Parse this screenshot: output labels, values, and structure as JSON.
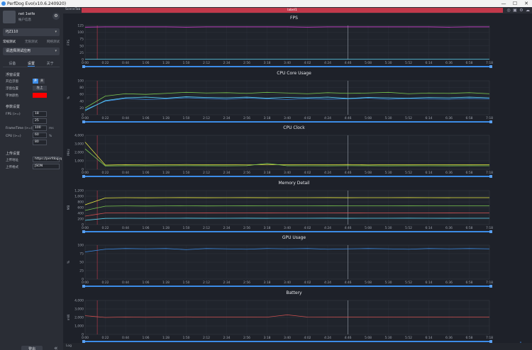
{
  "window": {
    "title": "PerfDog Evo(v10.6.240920)",
    "minimize": "—",
    "maximize": "☐",
    "close": "✕"
  },
  "user": {
    "name": "net 1wife",
    "status": "帐户信息",
    "bell": "⚙"
  },
  "device": {
    "label": "PJZ110",
    "dropdown": "▾"
  },
  "modes": [
    "常规测试",
    "无限测试",
    "网络测试"
  ],
  "app_select": {
    "label": "请选择测试应用",
    "dropdown": "▾"
  },
  "tabs": [
    "设备",
    "设置",
    "关于"
  ],
  "settings": {
    "section_float": "浮窗设置",
    "show_float": "开启浮窗",
    "show_float_on": "开",
    "show_float_off": "关",
    "float_position": "浮窗位置",
    "float_position_value": "左上",
    "font_color": "字体颜色",
    "font_color_hex": "#ff0000",
    "section_params": "参数设置",
    "fps_label": "FPS (>=)",
    "fps_v1": "18",
    "fps_v2": "25",
    "frametime_label": "FrameTime (>=)",
    "frametime_value": "100",
    "frametime_unit": "ms",
    "cpu_label": "CPU (>=)",
    "cpu_v1": "60",
    "cpu_v2": "80",
    "cpu_unit": "%",
    "section_upload": "上传设置",
    "upload_addr_label": "上传地址",
    "upload_addr_value": "https://perfdog.q",
    "upload_fmt_label": "上传格式",
    "upload_fmt_value": "JSON"
  },
  "footer": {
    "login": "登出",
    "collapse": "«",
    "log": "Log"
  },
  "topstrip": {
    "scene": "SceneTab",
    "label": "label1"
  },
  "colors": {
    "accent": "#3c8ce7",
    "label_bar": "#c2394b",
    "grid": "#2e323c"
  },
  "time_ticks": [
    "0:00",
    "0:22",
    "0:44",
    "1:06",
    "1:28",
    "1:50",
    "2:12",
    "2:34",
    "2:56",
    "3:18",
    "3:40",
    "4:02",
    "4:24",
    "4:46",
    "5:08",
    "5:30",
    "5:52",
    "6:14",
    "6:36",
    "6:58",
    "7:18"
  ],
  "chart_data": [
    {
      "type": "line",
      "title": "FPS",
      "ylabel": "FPS",
      "y_ticks": [
        "0",
        "25",
        "50",
        "75",
        "100",
        "125"
      ],
      "ylim": [
        0,
        125
      ],
      "series": [
        {
          "color": "#d040d0",
          "values": [
            119,
            120,
            120,
            120,
            120,
            119,
            120,
            120,
            120,
            120,
            120,
            119,
            120,
            120,
            120,
            120,
            120,
            120,
            119,
            120,
            120
          ]
        },
        {
          "color": "#5ad0f0",
          "values": [
            1,
            1,
            1,
            1,
            1,
            1,
            1,
            1,
            1,
            1,
            1,
            1,
            1,
            1,
            1,
            1,
            1,
            1,
            1,
            1,
            1
          ]
        }
      ]
    },
    {
      "type": "line",
      "title": "CPU Core Usage",
      "ylabel": "%",
      "y_ticks": [
        "0",
        "20",
        "40",
        "60",
        "80",
        "100"
      ],
      "ylim": [
        0,
        100
      ],
      "series": [
        {
          "color": "#7ac74f",
          "values": [
            20,
            55,
            62,
            60,
            63,
            66,
            64,
            65,
            63,
            66,
            64,
            62,
            65,
            63,
            64,
            66,
            62,
            64,
            63,
            65,
            62
          ]
        },
        {
          "color": "#3c8ce7",
          "values": [
            15,
            40,
            48,
            45,
            47,
            50,
            48,
            46,
            49,
            47,
            45,
            48,
            46,
            47,
            49,
            46,
            48,
            47,
            46,
            48,
            47
          ]
        },
        {
          "color": "#5ad0f0",
          "values": [
            12,
            42,
            50,
            52,
            49,
            53,
            51,
            50,
            52,
            49,
            51,
            50,
            52,
            48,
            51,
            50,
            49,
            51,
            50,
            52,
            50
          ]
        }
      ]
    },
    {
      "type": "line",
      "title": "CPU Clock",
      "ylabel": "MHz",
      "y_ticks": [
        "0",
        "1,000",
        "2,000",
        "3,000",
        "4,000"
      ],
      "ylim": [
        0,
        4000
      ],
      "series": [
        {
          "color": "#e8e840",
          "values": [
            3200,
            500,
            550,
            520,
            540,
            560,
            530,
            540,
            520,
            560,
            540,
            530,
            540,
            560,
            520,
            540,
            530,
            550,
            540,
            530,
            540
          ]
        },
        {
          "color": "#7ac74f",
          "values": [
            2400,
            400,
            420,
            410,
            415,
            430,
            420,
            410,
            425,
            700,
            420,
            415,
            410,
            425,
            420,
            410,
            420,
            415,
            410,
            420,
            415
          ]
        }
      ]
    },
    {
      "type": "line",
      "title": "Memory Detail",
      "ylabel": "MB",
      "y_ticks": [
        "0",
        "200",
        "400",
        "600",
        "800",
        "1,000",
        "1,200"
      ],
      "ylim": [
        0,
        1200
      ],
      "series": [
        {
          "color": "#e8e840",
          "values": [
            700,
            940,
            950,
            945,
            950,
            952,
            948,
            950,
            951,
            949,
            950,
            950,
            951,
            949,
            950,
            950,
            951,
            950,
            949,
            950,
            950
          ]
        },
        {
          "color": "#7ac74f",
          "values": [
            500,
            650,
            660,
            655,
            660,
            662,
            658,
            660,
            661,
            659,
            660,
            660,
            661,
            659,
            660,
            660,
            661,
            660,
            659,
            660,
            660
          ]
        },
        {
          "color": "#d05050",
          "values": [
            300,
            410,
            415,
            412,
            415,
            416,
            414,
            415,
            416,
            414,
            415,
            415,
            416,
            414,
            415,
            415,
            416,
            415,
            414,
            415,
            415
          ]
        },
        {
          "color": "#5ad0f0",
          "values": [
            150,
            220,
            225,
            222,
            225,
            226,
            224,
            225,
            226,
            224,
            225,
            225,
            226,
            224,
            225,
            225,
            226,
            225,
            224,
            225,
            225
          ]
        }
      ]
    },
    {
      "type": "line",
      "title": "GPU Usage",
      "ylabel": "%",
      "y_ticks": [
        "0",
        "25",
        "50",
        "75",
        "100"
      ],
      "ylim": [
        0,
        100
      ],
      "series": [
        {
          "color": "#3c8ce7",
          "values": [
            80,
            88,
            90,
            89,
            90,
            87,
            90,
            89,
            88,
            90,
            89,
            90,
            88,
            89,
            90,
            89,
            88,
            90,
            89,
            90,
            89
          ]
        }
      ]
    },
    {
      "type": "line",
      "title": "Battery",
      "ylabel": "mW",
      "y_ticks": [
        "0",
        "1,000",
        "2,000",
        "3,000",
        "4,000"
      ],
      "ylim": [
        0,
        4000
      ],
      "series": [
        {
          "color": "#d05050",
          "values": [
            2200,
            2000,
            2050,
            2020,
            2040,
            2060,
            2030,
            2040,
            2050,
            2030,
            2300,
            2040,
            2030,
            2050,
            2040,
            2030,
            2040,
            2050,
            2030,
            2040,
            2030
          ]
        }
      ]
    }
  ]
}
